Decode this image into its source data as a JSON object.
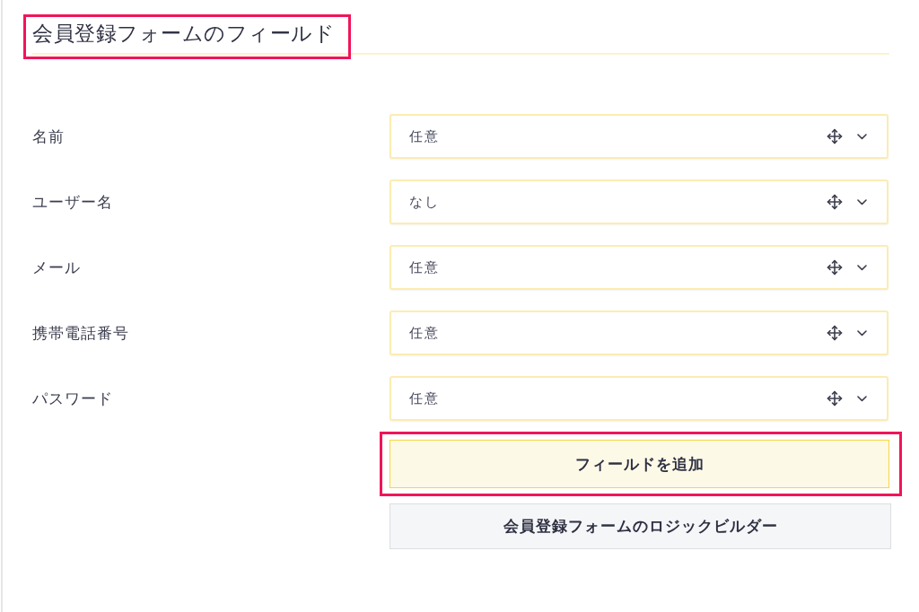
{
  "section": {
    "title": "会員登録フォームのフィールド",
    "highlighted": true
  },
  "fields": [
    {
      "label": "名前",
      "value": "任意"
    },
    {
      "label": "ユーザー名",
      "value": "なし"
    },
    {
      "label": "メール",
      "value": "任意"
    },
    {
      "label": "携帯電話番号",
      "value": "任意"
    },
    {
      "label": "パスワード",
      "value": "任意"
    }
  ],
  "buttons": [
    {
      "label": "フィールドを追加",
      "kind": "primary",
      "highlighted": true
    },
    {
      "label": "会員登録フォームのロジックビルダー",
      "kind": "secondary",
      "highlighted": false
    }
  ]
}
